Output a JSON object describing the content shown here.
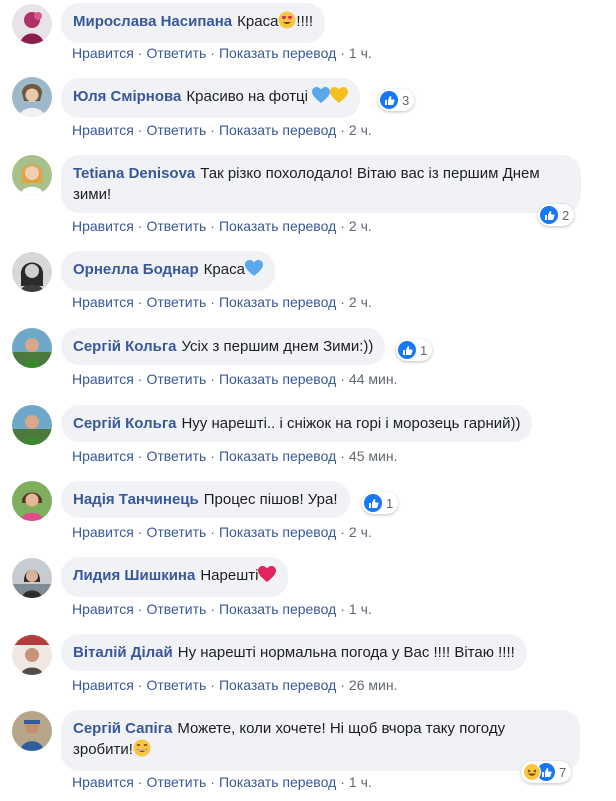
{
  "comments": [
    {
      "author": "Мирослава Насипана",
      "text": "Краса",
      "text_suffix": "!!!!",
      "emoji": "heart-eyes",
      "actions": {
        "like": "Нравится",
        "reply": "Ответить",
        "translate": "Показать перевод",
        "time": "1 ч."
      }
    },
    {
      "author": "Юля Смірнова",
      "text": "Красиво на фотці",
      "emoji": "blue-yellow-hearts",
      "reactions": {
        "type": "like",
        "count": "3"
      },
      "actions": {
        "like": "Нравится",
        "reply": "Ответить",
        "translate": "Показать перевод",
        "time": "2 ч."
      }
    },
    {
      "author": "Tetiana Denisova",
      "text": "Так різко похолодало! Вітаю вас із першим Днем зими!",
      "reactions": {
        "type": "like",
        "count": "2"
      },
      "actions": {
        "like": "Нравится",
        "reply": "Ответить",
        "translate": "Показать перевод",
        "time": "2 ч."
      }
    },
    {
      "author": "Орнелла Боднар",
      "text": "Краса",
      "emoji": "blue-heart",
      "actions": {
        "like": "Нравится",
        "reply": "Ответить",
        "translate": "Показать перевод",
        "time": "2 ч."
      }
    },
    {
      "author": "Сергій Кольга",
      "text": "Усіх з першим днем Зими:))",
      "reactions": {
        "type": "like",
        "count": "1"
      },
      "actions": {
        "like": "Нравится",
        "reply": "Ответить",
        "translate": "Показать перевод",
        "time": "44 мин."
      }
    },
    {
      "author": "Сергій Кольга",
      "text": "Нуу нарешті.. і сніжок на горі і морозець гарний))",
      "actions": {
        "like": "Нравится",
        "reply": "Ответить",
        "translate": "Показать перевод",
        "time": "45 мин."
      }
    },
    {
      "author": "Надія Танчинець",
      "text": "Процес пішов! Ура!",
      "reactions": {
        "type": "like",
        "count": "1"
      },
      "actions": {
        "like": "Нравится",
        "reply": "Ответить",
        "translate": "Показать перевод",
        "time": "2 ч."
      }
    },
    {
      "author": "Лидия Шишкина",
      "text": "Нарешті",
      "emoji": "red-heart",
      "actions": {
        "like": "Нравится",
        "reply": "Ответить",
        "translate": "Показать перевод",
        "time": "1 ч."
      }
    },
    {
      "author": "Віталій Ділай",
      "text": "Ну нарешті нормальна погода у Вас !!!! Вітаю !!!!",
      "actions": {
        "like": "Нравится",
        "reply": "Ответить",
        "translate": "Показать перевод",
        "time": "26 мин."
      }
    },
    {
      "author": "Сергій Сапіга",
      "text": "Можете, коли хочете! Ні щоб вчора таку погоду зробити!",
      "emoji": "grin",
      "reactions": {
        "type": "haha-like",
        "count": "7"
      },
      "actions": {
        "like": "Нравится",
        "reply": "Ответить",
        "translate": "Показать перевод",
        "time": "1 ч."
      }
    }
  ],
  "colors": {
    "author": "#385898",
    "bubble": "#f0f2f5",
    "like_blue": "#1877f2"
  }
}
